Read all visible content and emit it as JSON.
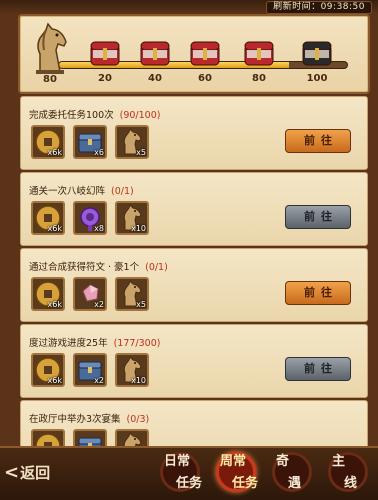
{
  "header": {
    "refresh_label": "刷新时间：09:38:50"
  },
  "progress": {
    "current": 80,
    "horse_value": "80",
    "fill_fraction": 0.8,
    "milestones": [
      {
        "value": "20",
        "chest_icon": "red-chest-icon"
      },
      {
        "value": "40",
        "chest_icon": "red-chest-icon"
      },
      {
        "value": "60",
        "chest_icon": "red-chest-icon"
      },
      {
        "value": "80",
        "chest_icon": "red-chest-icon"
      },
      {
        "value": "100",
        "chest_icon": "black-chest-icon"
      }
    ]
  },
  "tasks": [
    {
      "title": "完成委托任务100次",
      "progress": "(90/100)",
      "rewards": [
        {
          "icon": "coin-icon",
          "qty": "x6k"
        },
        {
          "icon": "chest-icon",
          "qty": "x6"
        },
        {
          "icon": "horse-icon",
          "qty": "x5"
        }
      ],
      "button": "前往",
      "button_state": "active"
    },
    {
      "title": "通关一次八岐幻阵",
      "progress": "(0/1)",
      "rewards": [
        {
          "icon": "coin-icon",
          "qty": "x6k"
        },
        {
          "icon": "purple-orb-icon",
          "qty": "x8"
        },
        {
          "icon": "horse-icon",
          "qty": "x10"
        }
      ],
      "button": "前往",
      "button_state": "inactive"
    },
    {
      "title": "通过合成获得符文 · 豪1个",
      "progress": "(0/1)",
      "rewards": [
        {
          "icon": "coin-icon",
          "qty": "x6k"
        },
        {
          "icon": "pink-crystal-icon",
          "qty": "x2"
        },
        {
          "icon": "horse-icon",
          "qty": "x5"
        }
      ],
      "button": "前往",
      "button_state": "active"
    },
    {
      "title": "度过游戏进度25年",
      "progress": "(177/300)",
      "rewards": [
        {
          "icon": "coin-icon",
          "qty": "x6k"
        },
        {
          "icon": "chest-icon",
          "qty": "x2"
        },
        {
          "icon": "horse-icon",
          "qty": "x10"
        }
      ],
      "button": "前往",
      "button_state": "inactive"
    },
    {
      "title": "在政厅中举办3次宴集",
      "progress": "(0/3)",
      "rewards": [
        {
          "icon": "coin-icon",
          "qty": ""
        },
        {
          "icon": "chest-icon",
          "qty": ""
        },
        {
          "icon": "horse-icon",
          "qty": ""
        }
      ],
      "button": "",
      "button_state": "active"
    }
  ],
  "bottom_nav": {
    "back_label": "返回",
    "tabs": [
      {
        "line1": "日常",
        "line2": "任务",
        "active": false
      },
      {
        "line1": "周常",
        "line2": "任务",
        "active": true
      },
      {
        "line1": "奇",
        "line2": "遇",
        "active": false
      },
      {
        "line1": "主",
        "line2": "线",
        "active": false
      }
    ]
  }
}
